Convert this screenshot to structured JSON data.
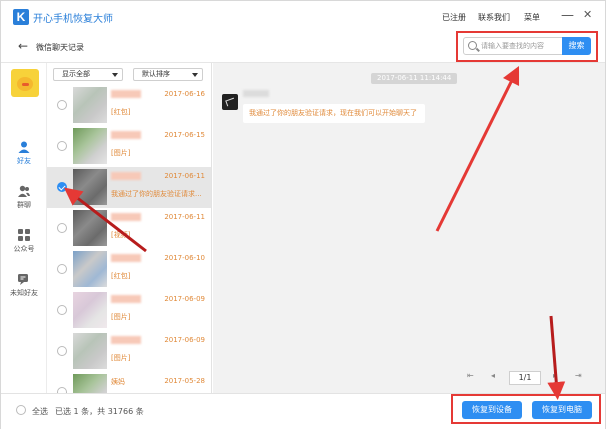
{
  "app": {
    "logo": "K",
    "title": "开心手机恢复大师"
  },
  "titlebar": {
    "registered": "已注册",
    "contact": "联系我们",
    "menu": "菜单",
    "minimize": "—",
    "close": "✕"
  },
  "subheader": {
    "back": "←",
    "title": "微信聊天记录"
  },
  "search": {
    "placeholder": "请输入要查找的内容",
    "button": "搜索"
  },
  "rail": {
    "items": [
      {
        "label": "好友",
        "icon": "person-icon",
        "active": true
      },
      {
        "label": "群聊",
        "icon": "group-icon",
        "active": false
      },
      {
        "label": "公众号",
        "icon": "grid-icon",
        "active": false
      },
      {
        "label": "未知好友",
        "icon": "unknown-friend-icon",
        "active": false
      }
    ]
  },
  "filters": {
    "show": "显示全部",
    "sort": "默认排序"
  },
  "list": [
    {
      "date": "2017-06-16",
      "msg": "[红包]",
      "checked": false
    },
    {
      "date": "2017-06-15",
      "msg": "[图片]",
      "checked": false
    },
    {
      "date": "2017-06-11",
      "msg": "我通过了你的朋友验证请求...",
      "checked": true
    },
    {
      "date": "2017-06-11",
      "msg": "[视频]",
      "checked": false
    },
    {
      "date": "2017-06-10",
      "msg": "[红包]",
      "checked": false
    },
    {
      "date": "2017-06-09",
      "msg": "[图片]",
      "checked": false
    },
    {
      "date": "2017-06-09",
      "msg": "[图片]",
      "checked": false
    },
    {
      "date": "2017-05-28",
      "msg": "姨妈",
      "checked": false
    }
  ],
  "chat": {
    "time": "2017-06-11 11:14:44",
    "message": "我通过了你的朋友验证请求，现在我们可以开始聊天了"
  },
  "pager": {
    "first": "⇤",
    "prev": "◂",
    "page": "1/1",
    "next": "▸",
    "last": "⇥"
  },
  "footer": {
    "select_all": "全选",
    "summary": "已选 1 条，共 31766 条",
    "restore_device": "恢复到设备",
    "restore_pc": "恢复到电脑"
  },
  "colors": {
    "accent": "#2e8ef2",
    "orange": "#e08a3a",
    "annotation": "#e53935"
  }
}
